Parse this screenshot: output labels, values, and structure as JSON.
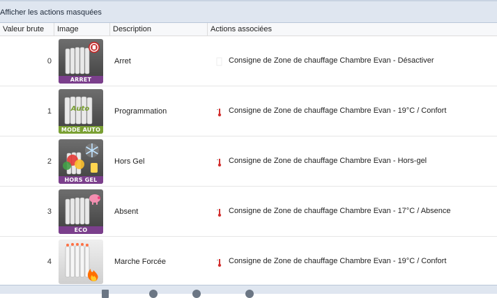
{
  "toolbar": {
    "show_hidden_label": "Afficher les actions masquées"
  },
  "table": {
    "headers": {
      "raw_value": "Valeur brute",
      "image": "Image",
      "description": "Description",
      "actions": "Actions associées"
    },
    "rows": [
      {
        "raw": "0",
        "badge": "ARRET",
        "description": "Arret",
        "action": "Consigne de Zone de chauffage Chambre Evan - Désactiver",
        "accent": "#7b3f8c"
      },
      {
        "raw": "1",
        "badge": "MODE AUTO",
        "description": "Programmation",
        "action": "Consigne de Zone de chauffage Chambre Evan - 19°C / Confort",
        "accent": "#7aa033"
      },
      {
        "raw": "2",
        "badge": "HORS GEL",
        "description": "Hors Gel",
        "action": "Consigne de Zone de chauffage Chambre Evan - Hors-gel",
        "accent": "#7b3f8c"
      },
      {
        "raw": "3",
        "badge": "ECO",
        "description": "Absent",
        "action": "Consigne de Zone de chauffage Chambre Evan - 17°C / Absence",
        "accent": "#7b3f8c"
      },
      {
        "raw": "4",
        "badge": "",
        "description": "Marche Forcée",
        "action": "Consigne de Zone de chauffage Chambre Evan - 19°C / Confort",
        "accent": "#cfcfcf"
      }
    ]
  },
  "icons": {
    "row_icons": [
      "radiator-stop-icon",
      "radiator-auto-icon",
      "radiator-frost-icon",
      "radiator-eco-icon",
      "radiator-flame-icon"
    ],
    "action_icon": "thermometer-icon"
  }
}
